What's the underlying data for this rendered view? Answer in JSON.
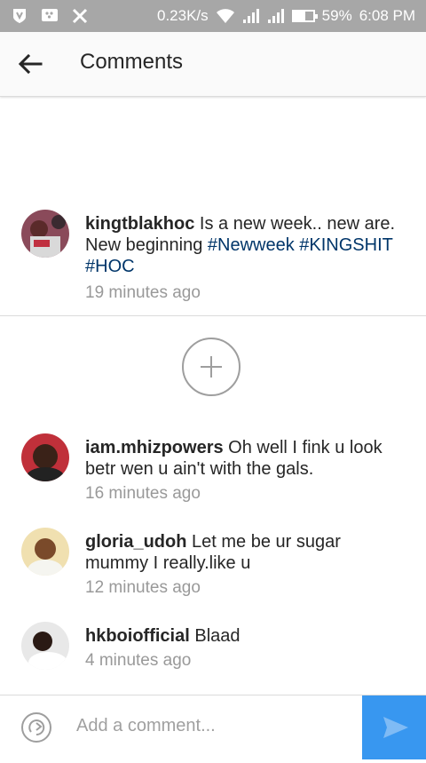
{
  "status_bar": {
    "speed": "0.23K/s",
    "battery_percent": "59%",
    "battery_level": 0.59,
    "time": "6:08 PM",
    "icons": [
      "vpn-shield-icon",
      "blackberry-messenger-icon",
      "tools-icon",
      "wifi-icon",
      "signal-icon",
      "signal-icon",
      "battery-icon"
    ]
  },
  "header": {
    "back_icon": "arrow-back-icon",
    "title": "Comments"
  },
  "caption": {
    "username": "kingtblakhoc",
    "text": "Is a new week.. new are. New beginning",
    "hashtags": [
      "#Newweek",
      "#KINGSHIT",
      "#HOC"
    ],
    "time": "19 minutes ago"
  },
  "load_more_icon": "plus-icon",
  "comments": [
    {
      "username": "iam.mhizpowers",
      "text": "Oh well I fink u look betr wen u ain't with the gals.",
      "time": "16 minutes ago"
    },
    {
      "username": "gloria_udoh",
      "text": "Let me be ur sugar mummy I really.like u",
      "time": "12 minutes ago"
    },
    {
      "username": "hkboiofficial",
      "text": "Blaad",
      "time": "4 minutes ago"
    }
  ],
  "composer": {
    "placeholder": "Add a comment...",
    "send_icon": "send-icon",
    "accent_color": "#3897f0"
  }
}
